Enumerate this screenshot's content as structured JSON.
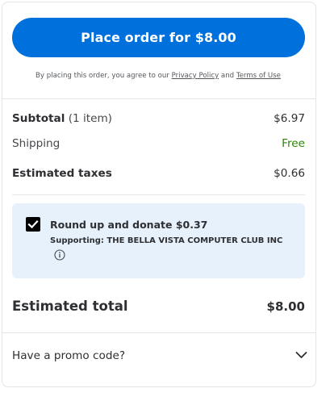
{
  "checkout": {
    "place_order_label": "Place order for $8.00",
    "legal": {
      "prefix": "By placing this order, you agree to our ",
      "privacy_link": "Privacy Policy",
      "and_text": " and ",
      "terms_link": "Terms of Use"
    },
    "summary": {
      "subtotal_label": "Subtotal",
      "subtotal_count": " (1 item)",
      "subtotal_value": "$6.97",
      "shipping_label": "Shipping",
      "shipping_value": "Free",
      "taxes_label": "Estimated taxes",
      "taxes_value": "$0.66"
    },
    "donation": {
      "checked": true,
      "title": "Round up and donate $0.37",
      "supporting": "Supporting: THE BELLA VISTA COMPUTER CLUB INC",
      "info_icon": "info-circle-icon"
    },
    "total": {
      "label": "Estimated total",
      "value": "$8.00"
    },
    "promo": {
      "label": "Have a promo code?",
      "icon": "chevron-down-icon"
    }
  },
  "colors": {
    "primary_button": "#0071dc",
    "free_shipping": "#2a8703",
    "donate_background": "#e6f1fc",
    "text": "#2e2f32"
  }
}
